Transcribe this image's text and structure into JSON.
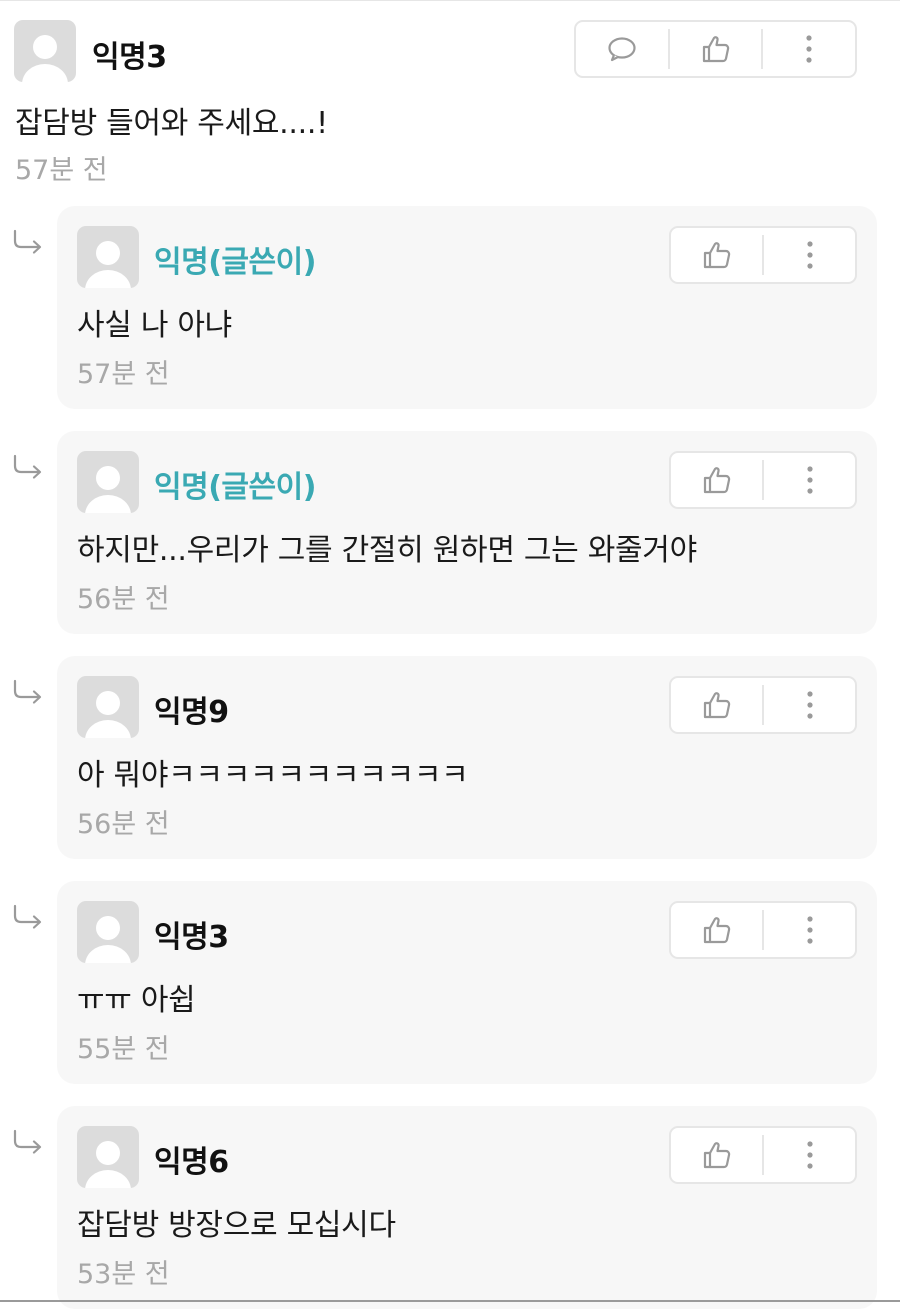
{
  "icons": {
    "comment": "speech-bubble-icon",
    "like": "thumbs-up-icon",
    "more": "vertical-dots-icon",
    "reply": "reply-arrow-icon",
    "avatar": "default-user-avatar-icon"
  },
  "colors": {
    "op_author": "#3aa9b3",
    "card_background": "#f7f7f7",
    "timestamp": "#a8a8a8"
  },
  "comment": {
    "author": "익명3",
    "text": "잡담방 들어와 주세요....!",
    "time": "57분 전"
  },
  "replies": [
    {
      "author": "익명(글쓴이)",
      "is_op": true,
      "text": "사실 나 아냐",
      "time": "57분 전"
    },
    {
      "author": "익명(글쓴이)",
      "is_op": true,
      "text": "하지만...우리가 그를 간절히 원하면 그는 와줄거야",
      "time": "56분 전"
    },
    {
      "author": "익명9",
      "is_op": false,
      "text": "아 뭐야ㅋㅋㅋㅋㅋㅋㅋㅋㅋㅋㅋ",
      "time": "56분 전"
    },
    {
      "author": "익명3",
      "is_op": false,
      "text": "ㅠㅠ 아쉽",
      "time": "55분 전"
    },
    {
      "author": "익명6",
      "is_op": false,
      "text": "잡담방 방장으로 모십시다",
      "time": "53분 전"
    }
  ]
}
